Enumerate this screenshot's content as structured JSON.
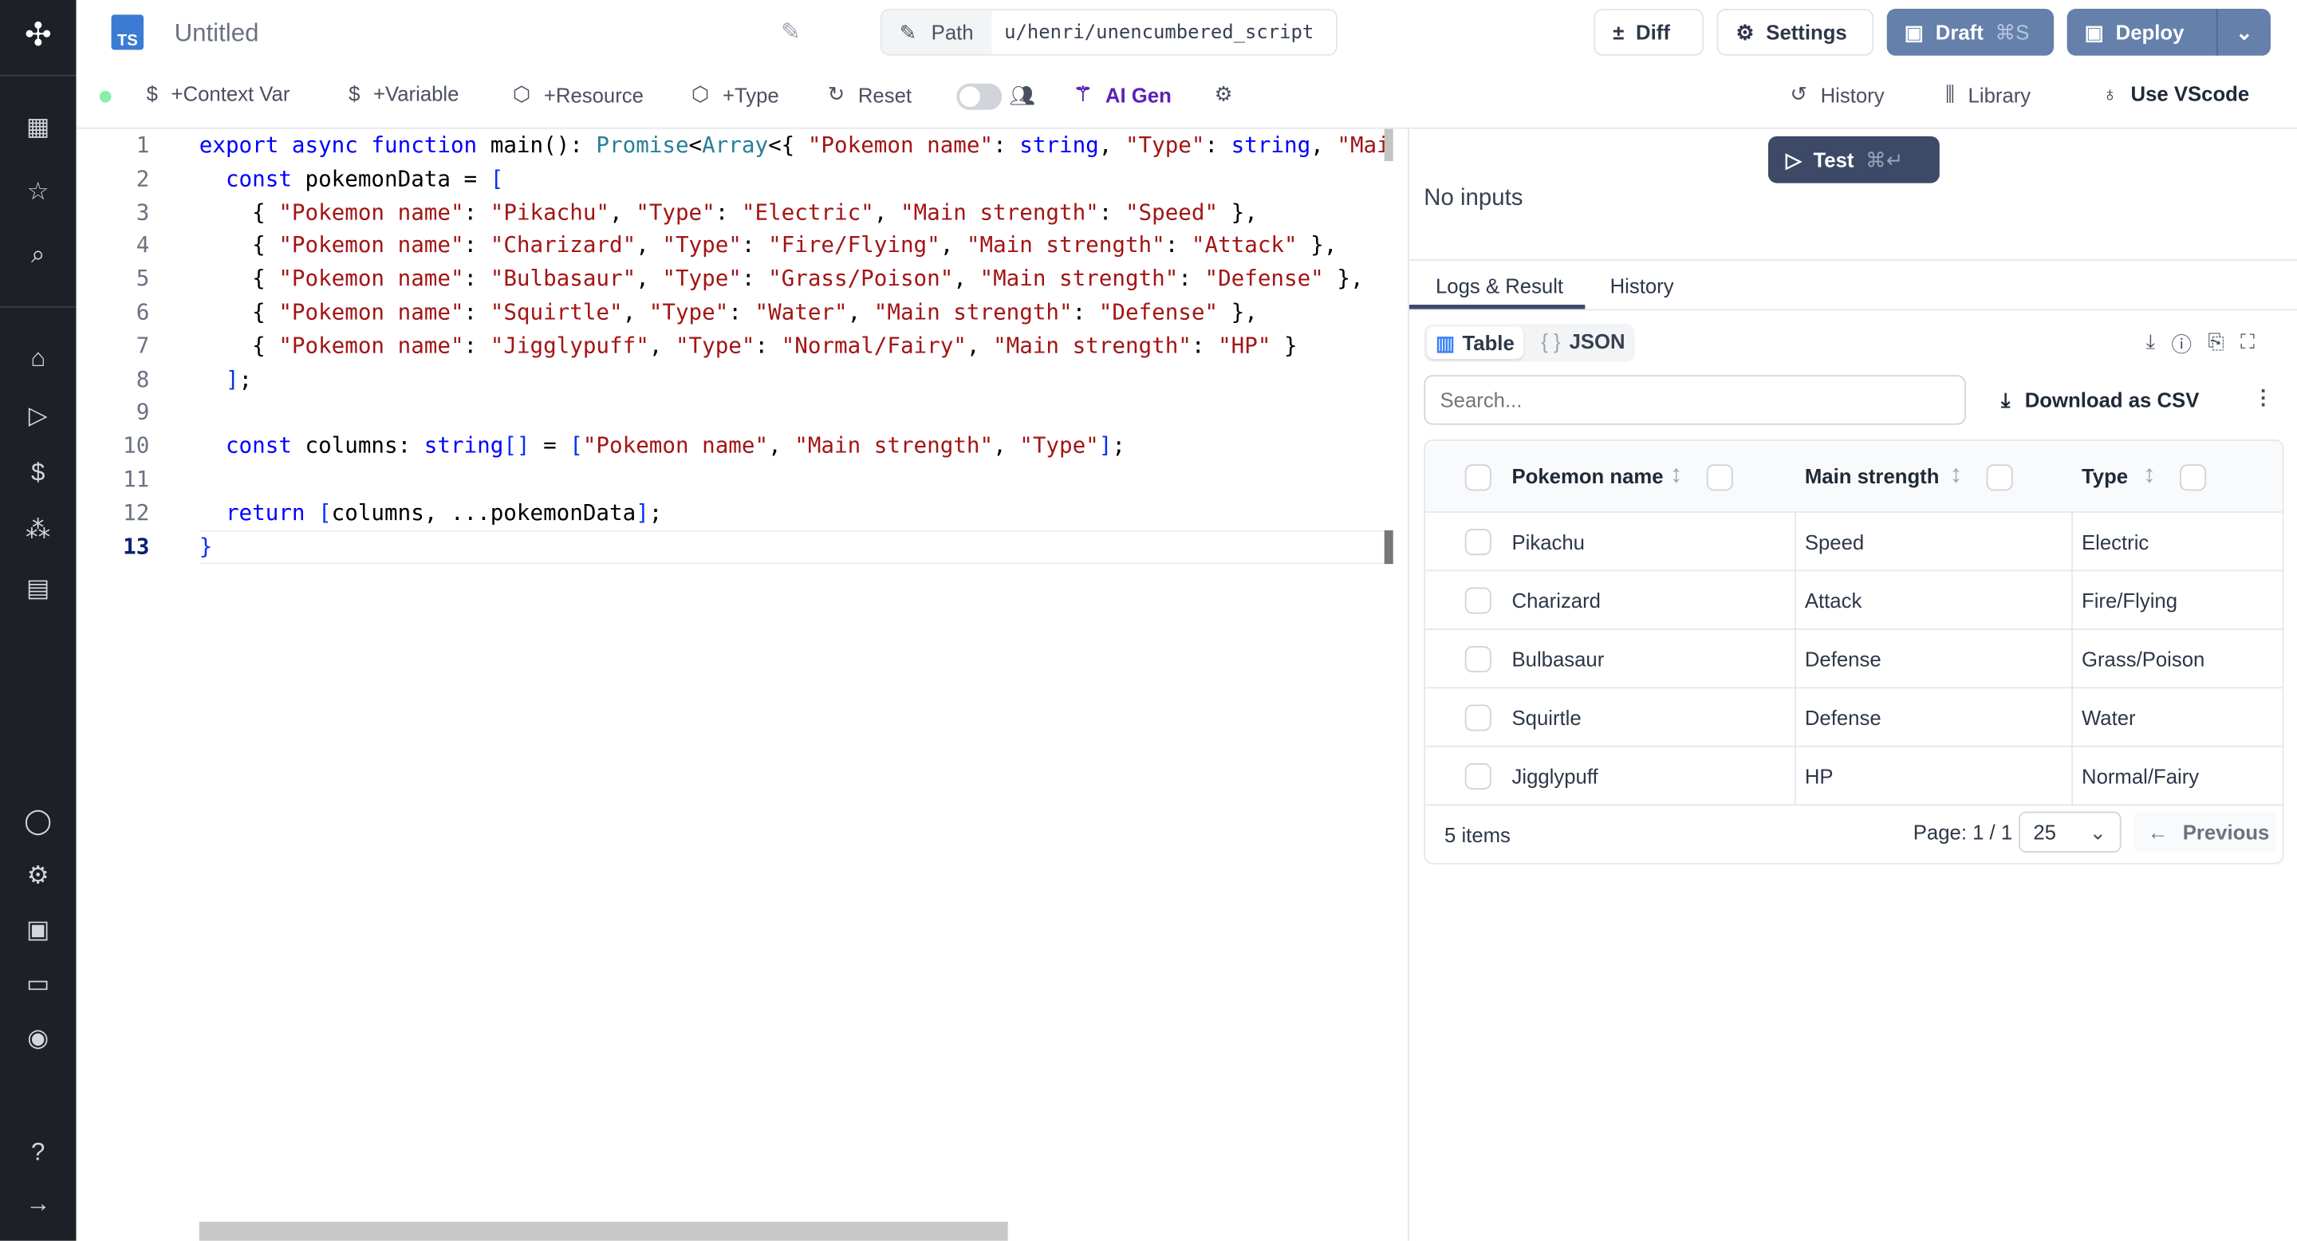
{
  "sidebar": {
    "items": [
      "logo-icon",
      "building-icon",
      "star-icon",
      "search-icon",
      "home-icon",
      "play-icon",
      "dollar-icon",
      "boxes-icon",
      "calendar-icon",
      "user-icon",
      "gear-icon",
      "bot-icon",
      "folder-icon",
      "eye-icon",
      "help-icon",
      "arrow-right-icon"
    ]
  },
  "header": {
    "lang_badge": "TS",
    "title": "Untitled",
    "path_label": "Path",
    "path_value": "u/henri/unencumbered_script",
    "diff": "Diff",
    "settings": "Settings",
    "draft": "Draft",
    "draft_shortcut": "⌘S",
    "deploy": "Deploy"
  },
  "toolbar": {
    "context_var": "+Context Var",
    "variable": "+Variable",
    "resource": "+Resource",
    "type": "+Type",
    "reset": "Reset",
    "ai_gen": "AI Gen",
    "history": "History",
    "library": "Library",
    "vscode": "Use VScode",
    "status_color": "#86efac",
    "ai_color": "#5b21b6"
  },
  "editor": {
    "current_line": 13,
    "lines": [
      [
        [
          "export async function ",
          "k"
        ],
        [
          "main",
          "f"
        ],
        [
          "(): ",
          ""
        ],
        [
          "Promise",
          "t"
        ],
        [
          "<",
          ""
        ],
        [
          "Array",
          "t"
        ],
        [
          "<{ ",
          ""
        ],
        [
          "\"Pokemon name\"",
          "s"
        ],
        [
          ": ",
          ""
        ],
        [
          "string",
          "k"
        ],
        [
          ", ",
          ""
        ],
        [
          "\"Type\"",
          "s"
        ],
        [
          ": ",
          ""
        ],
        [
          "string",
          "k"
        ],
        [
          ", ",
          ""
        ],
        [
          "\"Mai",
          "s"
        ]
      ],
      [
        [
          "  ",
          ""
        ],
        [
          "const ",
          "k"
        ],
        [
          "pokemonData = ",
          ""
        ],
        [
          "[",
          "p"
        ]
      ],
      [
        [
          "    { ",
          ""
        ],
        [
          "\"Pokemon name\"",
          "s"
        ],
        [
          ": ",
          ""
        ],
        [
          "\"Pikachu\"",
          "s"
        ],
        [
          ", ",
          ""
        ],
        [
          "\"Type\"",
          "s"
        ],
        [
          ": ",
          ""
        ],
        [
          "\"Electric\"",
          "s"
        ],
        [
          ", ",
          ""
        ],
        [
          "\"Main strength\"",
          "s"
        ],
        [
          ": ",
          ""
        ],
        [
          "\"Speed\"",
          "s"
        ],
        [
          " },",
          ""
        ]
      ],
      [
        [
          "    { ",
          ""
        ],
        [
          "\"Pokemon name\"",
          "s"
        ],
        [
          ": ",
          ""
        ],
        [
          "\"Charizard\"",
          "s"
        ],
        [
          ", ",
          ""
        ],
        [
          "\"Type\"",
          "s"
        ],
        [
          ": ",
          ""
        ],
        [
          "\"Fire/Flying\"",
          "s"
        ],
        [
          ", ",
          ""
        ],
        [
          "\"Main strength\"",
          "s"
        ],
        [
          ": ",
          ""
        ],
        [
          "\"Attack\"",
          "s"
        ],
        [
          " },",
          ""
        ]
      ],
      [
        [
          "    { ",
          ""
        ],
        [
          "\"Pokemon name\"",
          "s"
        ],
        [
          ": ",
          ""
        ],
        [
          "\"Bulbasaur\"",
          "s"
        ],
        [
          ", ",
          ""
        ],
        [
          "\"Type\"",
          "s"
        ],
        [
          ": ",
          ""
        ],
        [
          "\"Grass/Poison\"",
          "s"
        ],
        [
          ", ",
          ""
        ],
        [
          "\"Main strength\"",
          "s"
        ],
        [
          ": ",
          ""
        ],
        [
          "\"Defense\"",
          "s"
        ],
        [
          " },",
          ""
        ]
      ],
      [
        [
          "    { ",
          ""
        ],
        [
          "\"Pokemon name\"",
          "s"
        ],
        [
          ": ",
          ""
        ],
        [
          "\"Squirtle\"",
          "s"
        ],
        [
          ", ",
          ""
        ],
        [
          "\"Type\"",
          "s"
        ],
        [
          ": ",
          ""
        ],
        [
          "\"Water\"",
          "s"
        ],
        [
          ", ",
          ""
        ],
        [
          "\"Main strength\"",
          "s"
        ],
        [
          ": ",
          ""
        ],
        [
          "\"Defense\"",
          "s"
        ],
        [
          " },",
          ""
        ]
      ],
      [
        [
          "    { ",
          ""
        ],
        [
          "\"Pokemon name\"",
          "s"
        ],
        [
          ": ",
          ""
        ],
        [
          "\"Jigglypuff\"",
          "s"
        ],
        [
          ", ",
          ""
        ],
        [
          "\"Type\"",
          "s"
        ],
        [
          ": ",
          ""
        ],
        [
          "\"Normal/Fairy\"",
          "s"
        ],
        [
          ", ",
          ""
        ],
        [
          "\"Main strength\"",
          "s"
        ],
        [
          ": ",
          ""
        ],
        [
          "\"HP\"",
          "s"
        ],
        [
          " }",
          ""
        ]
      ],
      [
        [
          "  ",
          ""
        ],
        [
          "]",
          "p"
        ],
        [
          ";",
          ""
        ]
      ],
      [],
      [
        [
          "  ",
          ""
        ],
        [
          "const ",
          "k"
        ],
        [
          "columns: ",
          ""
        ],
        [
          "string",
          "k"
        ],
        [
          "[]",
          "p"
        ],
        [
          " = ",
          ""
        ],
        [
          "[",
          "p"
        ],
        [
          "\"Pokemon name\"",
          "s"
        ],
        [
          ", ",
          ""
        ],
        [
          "\"Main strength\"",
          "s"
        ],
        [
          ", ",
          ""
        ],
        [
          "\"Type\"",
          "s"
        ],
        [
          "]",
          "p"
        ],
        [
          ";",
          ""
        ]
      ],
      [],
      [
        [
          "  ",
          ""
        ],
        [
          "return ",
          "k"
        ],
        [
          "[",
          "p"
        ],
        [
          "columns, ...pokemonData",
          ""
        ],
        [
          "]",
          "p"
        ],
        [
          ";",
          ""
        ]
      ],
      [
        [
          "}",
          "p"
        ]
      ]
    ]
  },
  "run": {
    "test": "Test",
    "test_shortcut": "⌘↵",
    "no_inputs": "No inputs"
  },
  "tabs": [
    "Logs & Result",
    "History"
  ],
  "result": {
    "view_table": "Table",
    "view_json": "JSON",
    "search_placeholder": "Search...",
    "download_csv": "Download as CSV",
    "columns": [
      "Pokemon name",
      "Main strength",
      "Type"
    ],
    "rows": [
      [
        "Pikachu",
        "Speed",
        "Electric"
      ],
      [
        "Charizard",
        "Attack",
        "Fire/Flying"
      ],
      [
        "Bulbasaur",
        "Defense",
        "Grass/Poison"
      ],
      [
        "Squirtle",
        "Defense",
        "Water"
      ],
      [
        "Jigglypuff",
        "HP",
        "Normal/Fairy"
      ]
    ],
    "items": "5 items",
    "page": "Page: 1 / 1",
    "page_size": "25",
    "previous": "Previous"
  }
}
